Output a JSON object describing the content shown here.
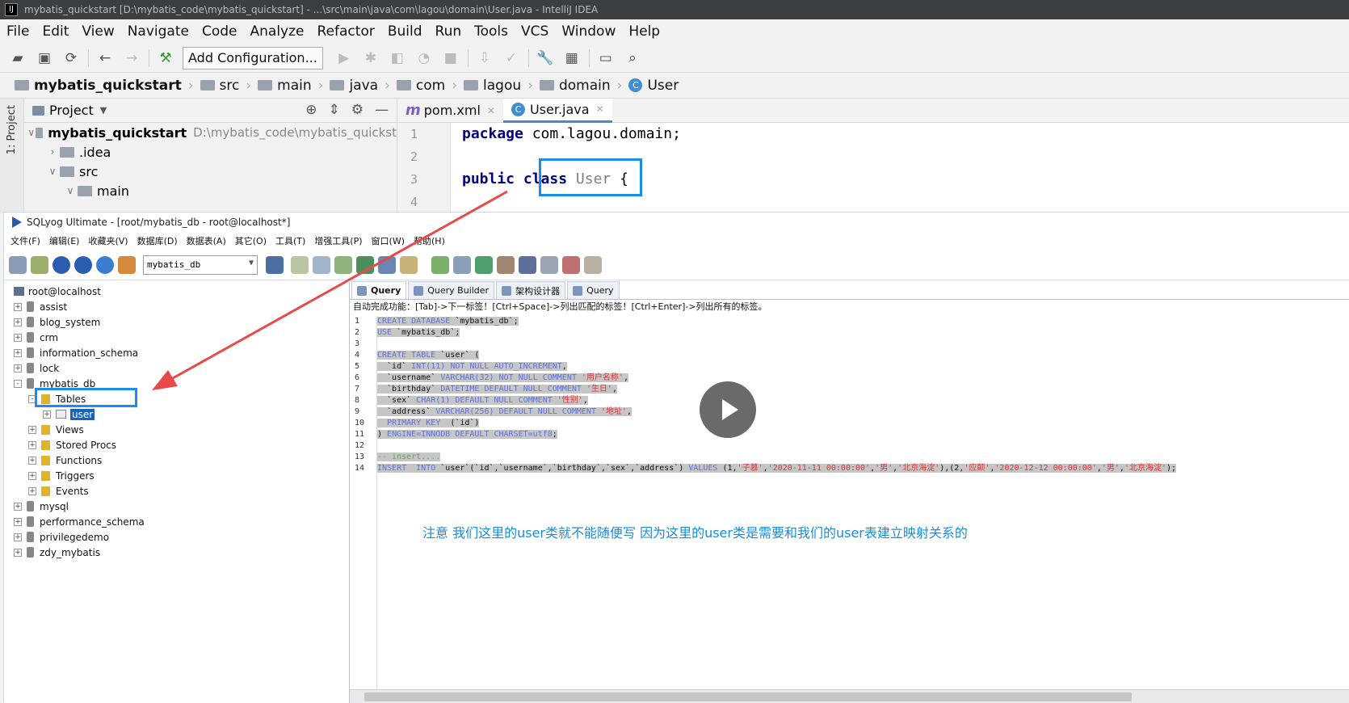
{
  "intellij": {
    "window_title": "mybatis_quickstart [D:\\mybatis_code\\mybatis_quickstart] - ...\\src\\main\\java\\com\\lagou\\domain\\User.java - IntelliJ IDEA",
    "menu": [
      "File",
      "Edit",
      "View",
      "Navigate",
      "Code",
      "Analyze",
      "Refactor",
      "Build",
      "Run",
      "Tools",
      "VCS",
      "Window",
      "Help"
    ],
    "toolbar": {
      "add_configuration": "Add Configuration..."
    },
    "breadcrumb": [
      "mybatis_quickstart",
      "src",
      "main",
      "java",
      "com",
      "lagou",
      "domain",
      "User"
    ],
    "side_tab": "1: Project",
    "project_panel": {
      "title": "Project",
      "tree": [
        {
          "label": "mybatis_quickstart",
          "path": "D:\\mybatis_code\\mybatis_quickst",
          "indent": 0,
          "arrow": "down",
          "bold": true
        },
        {
          "label": ".idea",
          "indent": 1,
          "arrow": "right"
        },
        {
          "label": "src",
          "indent": 1,
          "arrow": "down"
        },
        {
          "label": "main",
          "indent": 2,
          "arrow": "down"
        }
      ]
    },
    "editor_tabs": [
      {
        "label": "pom.xml",
        "active": false
      },
      {
        "label": "User.java",
        "active": true
      }
    ],
    "line_numbers": [
      "1",
      "2",
      "3",
      "4"
    ],
    "code": {
      "package_kw": "package",
      "package_name": "com.lagou.domain;",
      "public_kw": "public",
      "class_kw": "class",
      "class_name": "User",
      "brace": "{"
    }
  },
  "sqlyog": {
    "window_title": "SQLyog Ultimate - [root/mybatis_db - root@localhost*]",
    "menu": [
      "文件(F)",
      "编辑(E)",
      "收藏夹(V)",
      "数据库(D)",
      "数据表(A)",
      "其它(O)",
      "工具(T)",
      "增强工具(P)",
      "窗口(W)",
      "帮助(H)"
    ],
    "db_selector": "mybatis_db",
    "tree": [
      {
        "label": "root@localhost",
        "type": "root",
        "indent": 0
      },
      {
        "label": "assist",
        "type": "db",
        "indent": 0,
        "pm": "+"
      },
      {
        "label": "blog_system",
        "type": "db",
        "indent": 0,
        "pm": "+"
      },
      {
        "label": "crm",
        "type": "db",
        "indent": 0,
        "pm": "+"
      },
      {
        "label": "information_schema",
        "type": "db",
        "indent": 0,
        "pm": "+"
      },
      {
        "label": "lock",
        "type": "db",
        "indent": 0,
        "pm": "+"
      },
      {
        "label": "mybatis_db",
        "type": "db",
        "indent": 0,
        "pm": "-"
      },
      {
        "label": "Tables",
        "type": "folder",
        "indent": 1,
        "pm": "-"
      },
      {
        "label": "user",
        "type": "table",
        "indent": 2,
        "pm": "+",
        "selected": true
      },
      {
        "label": "Views",
        "type": "folder",
        "indent": 1,
        "pm": "+"
      },
      {
        "label": "Stored Procs",
        "type": "folder",
        "indent": 1,
        "pm": "+"
      },
      {
        "label": "Functions",
        "type": "folder",
        "indent": 1,
        "pm": "+"
      },
      {
        "label": "Triggers",
        "type": "folder",
        "indent": 1,
        "pm": "+"
      },
      {
        "label": "Events",
        "type": "folder",
        "indent": 1,
        "pm": "+"
      },
      {
        "label": "mysql",
        "type": "db",
        "indent": 0,
        "pm": "+"
      },
      {
        "label": "performance_schema",
        "type": "db",
        "indent": 0,
        "pm": "+"
      },
      {
        "label": "privilegedemo",
        "type": "db",
        "indent": 0,
        "pm": "+"
      },
      {
        "label": "zdy_mybatis",
        "type": "db",
        "indent": 0,
        "pm": "+"
      }
    ],
    "tabs": [
      {
        "label": "Query",
        "active": true
      },
      {
        "label": "Query Builder",
        "active": false
      },
      {
        "label": "架构设计器",
        "active": false
      },
      {
        "label": "Query",
        "active": false
      }
    ],
    "autocomplete_hint": "自动完成功能：[Tab]->下一标签！[Ctrl+Space]->列出匹配的标签！[Ctrl+Enter]->列出所有的标签。",
    "line_numbers": [
      "1",
      "2",
      "3",
      "4",
      "5",
      "6",
      "7",
      "8",
      "9",
      "10",
      "11",
      "12",
      "13",
      "14"
    ],
    "sql_lines": [
      [
        {
          "t": "CREATE DATABASE ",
          "c": "k"
        },
        {
          "t": "`mybatis_db`;",
          "c": ""
        }
      ],
      [
        {
          "t": "USE ",
          "c": "k"
        },
        {
          "t": "`mybatis_db`;",
          "c": ""
        }
      ],
      [],
      [
        {
          "t": "CREATE TABLE ",
          "c": "k"
        },
        {
          "t": "`user` (",
          "c": ""
        }
      ],
      [
        {
          "t": "  `id` ",
          "c": ""
        },
        {
          "t": "INT(11) NOT NULL AUTO_INCREMENT",
          "c": "k"
        },
        {
          "t": ",",
          "c": ""
        }
      ],
      [
        {
          "t": "  `username` ",
          "c": ""
        },
        {
          "t": "VARCHAR(32) NOT NULL COMMENT ",
          "c": "k"
        },
        {
          "t": "'用户名称'",
          "c": "s"
        },
        {
          "t": ",",
          "c": ""
        }
      ],
      [
        {
          "t": "  `birthday` ",
          "c": ""
        },
        {
          "t": "DATETIME DEFAULT NULL COMMENT ",
          "c": "k"
        },
        {
          "t": "'生日'",
          "c": "s"
        },
        {
          "t": ",",
          "c": ""
        }
      ],
      [
        {
          "t": "  `sex` ",
          "c": ""
        },
        {
          "t": "CHAR(1) DEFAULT NULL COMMENT ",
          "c": "k"
        },
        {
          "t": "'性别'",
          "c": "s"
        },
        {
          "t": ",",
          "c": ""
        }
      ],
      [
        {
          "t": "  `address` ",
          "c": ""
        },
        {
          "t": "VARCHAR(256) DEFAULT NULL COMMENT ",
          "c": "k"
        },
        {
          "t": "'地址'",
          "c": "s"
        },
        {
          "t": ",",
          "c": ""
        }
      ],
      [
        {
          "t": "  PRIMARY KEY ",
          "c": "k"
        },
        {
          "t": " (`id`)",
          "c": ""
        }
      ],
      [
        {
          "t": ") ",
          "c": ""
        },
        {
          "t": "ENGINE=INNODB DEFAULT CHARSET=utf8",
          "c": "k"
        },
        {
          "t": ";",
          "c": ""
        }
      ],
      [],
      [
        {
          "t": "-- insert....",
          "c": "c"
        }
      ],
      [
        {
          "t": "INSERT  INTO ",
          "c": "k"
        },
        {
          "t": "`user`(`id`,`username`,`birthday`,`sex`,`address`) ",
          "c": ""
        },
        {
          "t": "VALUES ",
          "c": "k"
        },
        {
          "t": "(1,",
          "c": ""
        },
        {
          "t": "'子慕'",
          "c": "s"
        },
        {
          "t": ",",
          "c": ""
        },
        {
          "t": "'2020-11-11 00:00:00'",
          "c": "s"
        },
        {
          "t": ",",
          "c": ""
        },
        {
          "t": "'男'",
          "c": "s"
        },
        {
          "t": ",",
          "c": ""
        },
        {
          "t": "'北京海淀'",
          "c": "s"
        },
        {
          "t": "),(2,",
          "c": ""
        },
        {
          "t": "'应颠'",
          "c": "s"
        },
        {
          "t": ",",
          "c": ""
        },
        {
          "t": "'2020-12-12 00:00:00'",
          "c": "s"
        },
        {
          "t": ",",
          "c": ""
        },
        {
          "t": "'男'",
          "c": "s"
        },
        {
          "t": ",",
          "c": ""
        },
        {
          "t": "'北京海淀'",
          "c": "s"
        },
        {
          "t": ");",
          "c": ""
        }
      ]
    ]
  },
  "annotation_note": "注意 我们这里的user类就不能随便写 因为这里的user类是需要和我们的user表建立映射关系的",
  "colors": {
    "highlight_box": "#1a8cf0",
    "arrow": "#e84a4a",
    "note_text": "#1a8cd8"
  }
}
